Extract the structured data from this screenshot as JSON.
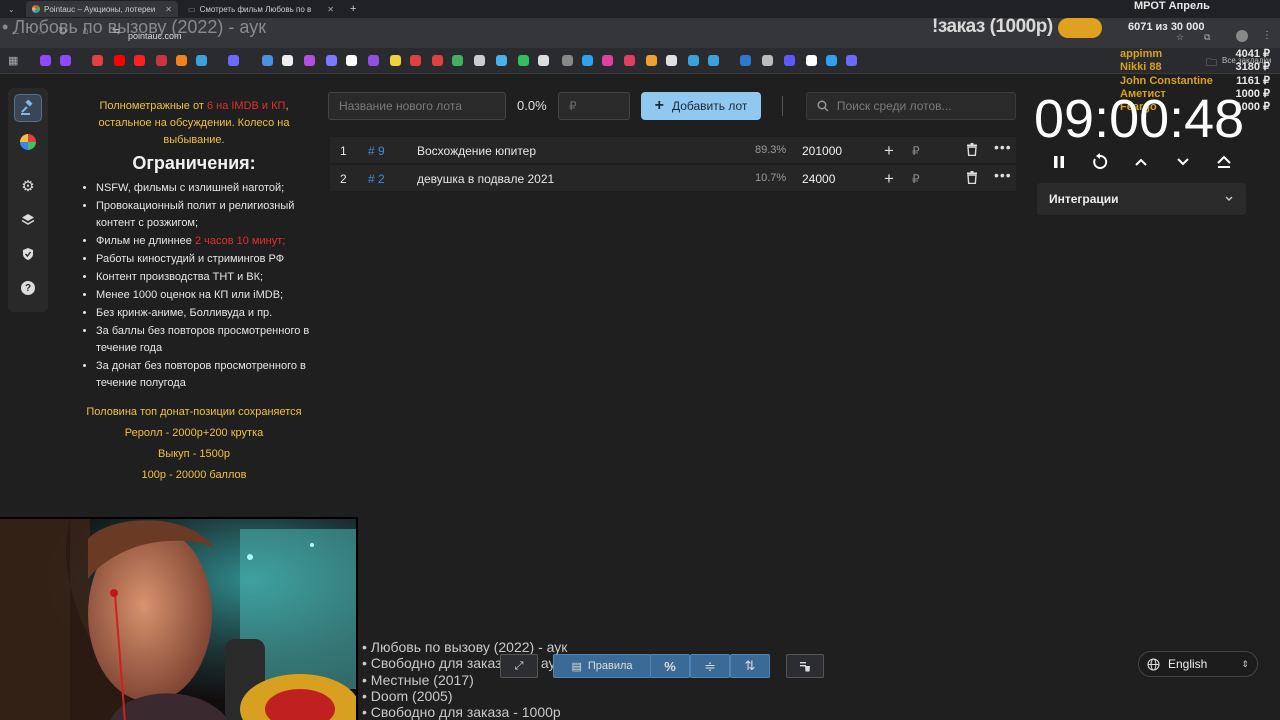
{
  "browser": {
    "tabs": [
      {
        "title": "Pointauc – Аукционы, лотереи",
        "active": true
      },
      {
        "title": "Смотреть фильм Любовь по в",
        "active": false
      }
    ],
    "url": "pointauc.com",
    "other_bookmarks": "Все закладки"
  },
  "overlay": {
    "title": "• Любовь по вызову (2022) - аук",
    "order_banner": "!заказ (1000р)",
    "mrot_title": "МРОТ Апрель",
    "mrot_count": "6071  из 30 000",
    "donors": [
      {
        "name": "appimm",
        "amount": "4041 ₽"
      },
      {
        "name": "Nikki 88",
        "amount": "3180 ₽"
      },
      {
        "name": "John Constantine",
        "amount": "1161 ₽"
      },
      {
        "name": "Аметист",
        "amount": "1000 ₽"
      },
      {
        "name": "Feargo",
        "amount": "1000 ₽"
      }
    ],
    "playlist": [
      "• Любовь по вызову (2022) - аук",
      "• Свободно для заказа или аукциона",
      "• Местные (2017)",
      "• Doom (2005)",
      "• Свободно для заказа - 1000р"
    ]
  },
  "rules": {
    "intro_a": "Полнометражные от ",
    "intro_red": "6 на IMDB и КП",
    "intro_b": ", остальное на обсуждении. Колесо на выбывание.",
    "heading": "Ограничения:",
    "items": [
      "NSFW, фильмы с излишней наготой;",
      "Провокационный полит и религиозный контент с розжигом;",
      "Фильм не длиннее ",
      "Работы киностудий и стримингов РФ",
      "Контент производства ТНТ и ВК;",
      "Менее 1000 оценок на КП или iMDB;",
      "Без кринж-аниме, Болливуда и пр.",
      "За баллы без повторов просмотренного в течение года",
      "За донат без повторов просмотренного в течение полугода"
    ],
    "duration_red": "2 часов 10 минут;",
    "footer": [
      "Половина топ донат-позиции сохраняется",
      "Реролл - 2000р+200 крутка",
      "Выкуп - 1500р",
      "100р - 20000 баллов"
    ]
  },
  "toolbar": {
    "lot_name_placeholder": "Название нового лота",
    "percent": "0.0%",
    "amount_placeholder": "₽",
    "add_lot_label": "Добавить лот",
    "search_placeholder": "Поиск среди лотов..."
  },
  "lots": [
    {
      "index": "1",
      "number": "# 9",
      "name": "Восхождение юпитер",
      "percent": "89.3%",
      "amount": "201000",
      "currency": "₽"
    },
    {
      "index": "2",
      "number": "# 2",
      "name": "девушка в подвале 2021",
      "percent": "10.7%",
      "amount": "24000",
      "currency": "₽"
    }
  ],
  "timer": {
    "value": "09:00:48",
    "integrations_label": "Интеграции"
  },
  "bottom_bar": {
    "rules_label": "Правила",
    "percent_label": "%"
  },
  "language": {
    "selected": "English"
  },
  "colors": {
    "accent_blue": "#90c8f0",
    "warning_yellow": "#f0c040",
    "red": "#e03030",
    "lot_number_blue": "#3b8fd6"
  }
}
